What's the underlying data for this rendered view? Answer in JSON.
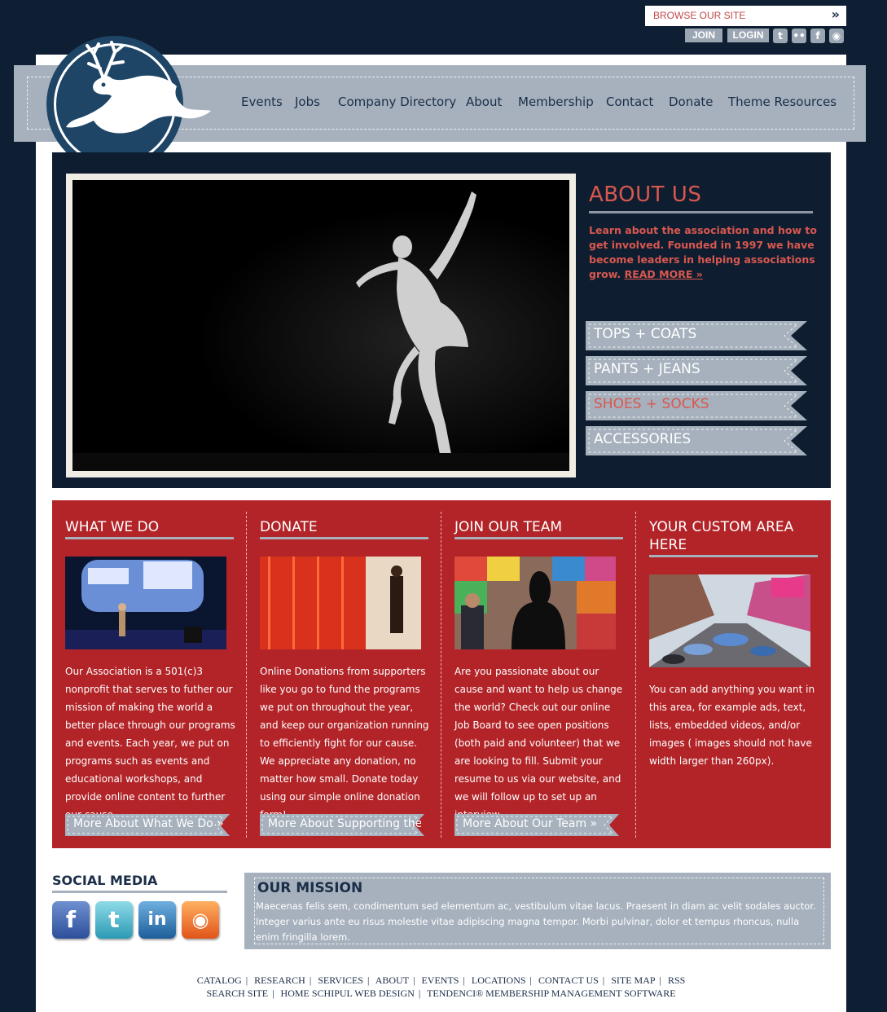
{
  "utility": {
    "browse_label": "BROWSE OUR SITE",
    "browse_arrow": "»",
    "join_label": "JOIN",
    "login_label": "LOGIN",
    "icons": [
      "twitter-icon",
      "flickr-icon",
      "facebook-icon",
      "rss-icon"
    ]
  },
  "nav": {
    "items": [
      "Events",
      "Jobs",
      "Company Directory",
      "About",
      "Membership",
      "Contact",
      "Donate",
      "Theme Resources"
    ]
  },
  "about": {
    "title": "ABOUT US",
    "text": "Learn about the association and how to get involved. Founded in 1997 we have become leaders in helping associations grow.",
    "read_more": "READ MORE »"
  },
  "ribbons": [
    {
      "label": "TOPS + COATS",
      "active": false
    },
    {
      "label": "PANTS + JEANS",
      "active": false
    },
    {
      "label": "SHOES + SOCKS",
      "active": true
    },
    {
      "label": "ACCESSORIES",
      "active": false
    }
  ],
  "columns": [
    {
      "title": "WHAT WE DO",
      "text": "Our Association is a 501(c)3 nonprofit that serves to futher our mission of making the world a better place through our programs and events. Each year, we put on programs such as events and educational workshops, and provide online content to further our cause.",
      "more": "More About What We Do »"
    },
    {
      "title": "DONATE",
      "text": "Online Donations from supporters like you go to fund the programs we put on throughout the year, and keep our organization running to efficiently fight for our cause. We appreciate any donation, no matter how small. Donate today using our simple online donation form!",
      "more": "More About Supporting the"
    },
    {
      "title": "JOIN OUR TEAM",
      "text": "Are you passionate about our cause and want to help us change the world? Check out our online Job Board to see open positions (both paid and volunteer) that we are looking to fill. Submit your resume to us via our website, and we will follow up to set up an interview.",
      "more": "More About Our Team »"
    },
    {
      "title": "YOUR CUSTOM AREA HERE",
      "text": "You can add anything you want in this area, for example ads, text, lists, embedded videos, and/or images ( images should not have width larger than 260px)."
    }
  ],
  "social": {
    "title": "SOCIAL MEDIA",
    "icons": [
      "facebook-icon",
      "twitter-icon",
      "linkedin-icon",
      "rss-icon"
    ]
  },
  "mission": {
    "title": "OUR MISSION",
    "text": "Maecenas felis sem, condimentum sed elementum ac, vestibulum vitae lacus. Praesent in diam ac velit sodales auctor. Integer varius ante eu risus molestie vitae adipiscing magna tempor. Morbi pulvinar, dolor et tempus rhoncus, nulla enim fringilla lorem."
  },
  "footer": {
    "row1": [
      "CATALOG",
      "RESEARCH",
      "SERVICES",
      "ABOUT",
      "EVENTS",
      "LOCATIONS",
      "CONTACT US",
      "SITE MAP",
      "RSS"
    ],
    "row2": [
      "SEARCH SITE",
      "HOME SCHIPUL WEB DESIGN",
      "TENDENCI® MEMBERSHIP MANAGEMENT SOFTWARE"
    ]
  },
  "colors": {
    "navy": "#0f1f33",
    "accent_red": "#b22428",
    "salmon": "#d9574f",
    "slate": "#a6b1bd"
  }
}
